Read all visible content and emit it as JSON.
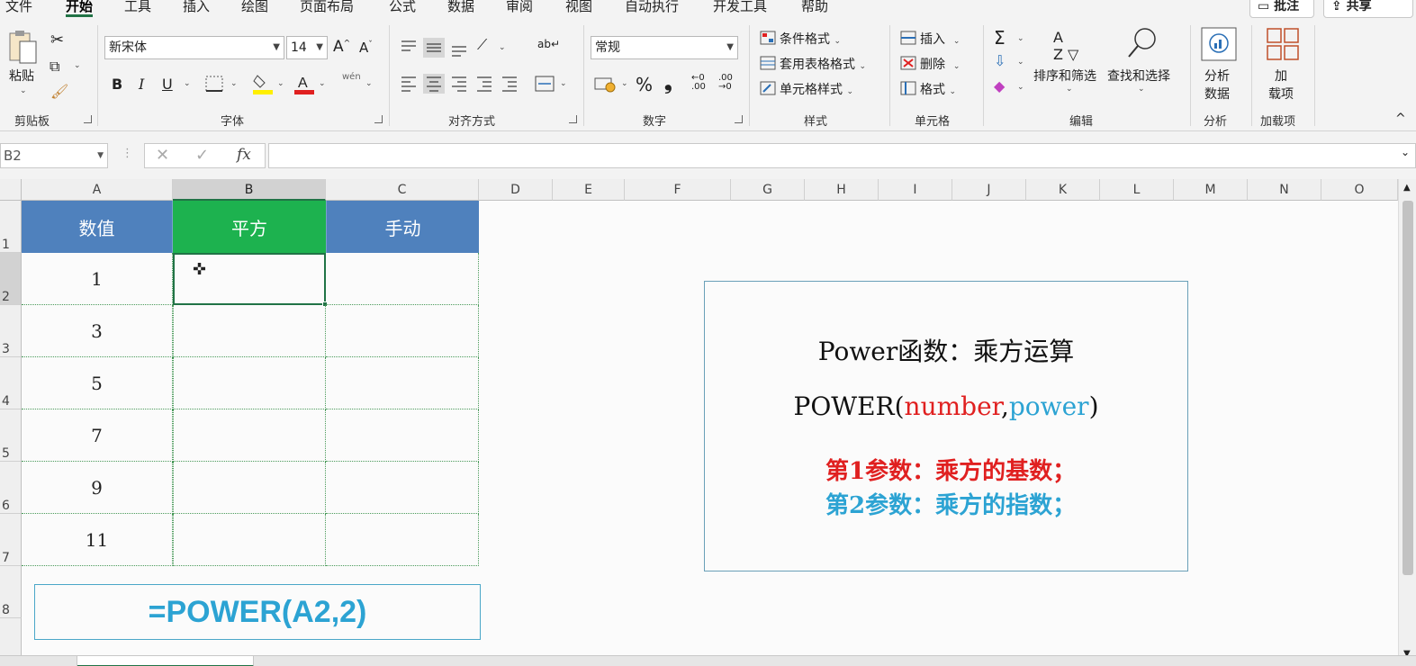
{
  "menu": {
    "tabs": [
      "文件",
      "开始",
      "工具",
      "插入",
      "绘图",
      "页面布局",
      "公式",
      "数据",
      "审阅",
      "视图",
      "自动执行",
      "开发工具",
      "帮助"
    ],
    "active_tab": "开始",
    "comments_btn": "批注",
    "share_btn": "共享"
  },
  "ribbon": {
    "clipboard": {
      "paste": "粘贴",
      "label": "剪贴板"
    },
    "font": {
      "name": "新宋体",
      "size": "14",
      "bold": "B",
      "italic": "I",
      "underline": "U",
      "label": "字体",
      "phonetic": "wén"
    },
    "alignment": {
      "label": "对齐方式"
    },
    "number": {
      "format": "常规",
      "label": "数字",
      "percent": "%"
    },
    "styles": {
      "conditional": "条件格式",
      "table": "套用表格格式",
      "cell_styles": "单元格样式",
      "label": "样式"
    },
    "cells": {
      "insert": "插入",
      "delete": "删除",
      "format": "格式",
      "label": "单元格"
    },
    "editing": {
      "sort_filter": "排序和筛选",
      "find_select": "查找和选择",
      "label": "编辑"
    },
    "analysis": {
      "analyze_line1": "分析",
      "analyze_line2": "数据",
      "label": "分析"
    },
    "addins": {
      "line1": "加",
      "line2": "载项",
      "label": "加载项"
    }
  },
  "formula_bar": {
    "name_box": "B2",
    "fx": "fx",
    "value": ""
  },
  "columns": [
    "A",
    "B",
    "C",
    "D",
    "E",
    "F",
    "G",
    "H",
    "I",
    "J",
    "K",
    "L",
    "M",
    "N",
    "O"
  ],
  "rows": [
    "1",
    "2",
    "3",
    "4",
    "5",
    "6",
    "7",
    "8"
  ],
  "table": {
    "headers": [
      "数值",
      "平方",
      "手动"
    ],
    "values": [
      "1",
      "3",
      "5",
      "7",
      "9",
      "11"
    ]
  },
  "info_box": {
    "title": "Power函数：乘方运算",
    "syntax_prefix": "POWER(",
    "syntax_arg1": "number",
    "syntax_comma": ",",
    "syntax_arg2": "power",
    "syntax_suffix": ")",
    "param1": "第1参数：乘方的基数；",
    "param2": "第2参数：乘方的指数；"
  },
  "formula_example": "=POWER(A2,2)",
  "colors": {
    "header_blue": "#4f81bd",
    "header_green": "#1db24f",
    "accent": "#217346",
    "red": "#e02020",
    "blue": "#2ca3d3"
  }
}
